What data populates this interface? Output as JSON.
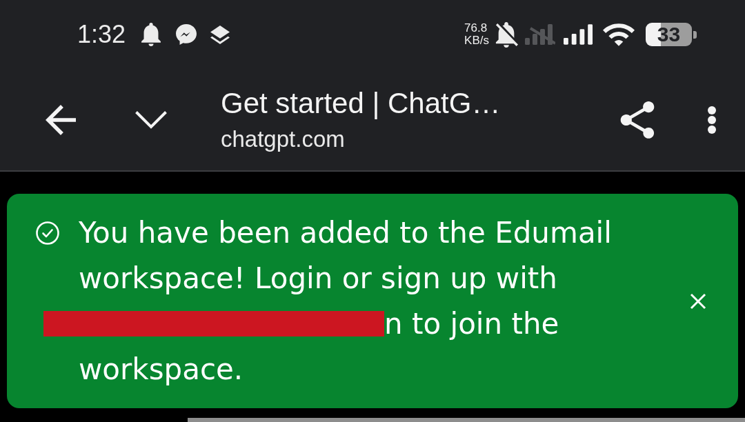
{
  "status_bar": {
    "time": "1:32",
    "network_speed": {
      "value": "76.8",
      "unit": "KB/s"
    },
    "battery": "33"
  },
  "toolbar": {
    "title": "Get started | ChatG…",
    "url": "chatgpt.com"
  },
  "banner": {
    "message": [
      {
        "kind": "text",
        "text": "You have been added to the Edumail workspace! Login or sign up with"
      },
      {
        "kind": "redacted"
      },
      {
        "kind": "text",
        "text": "n to join the"
      },
      {
        "kind": "text",
        "text": "workspace."
      }
    ]
  }
}
